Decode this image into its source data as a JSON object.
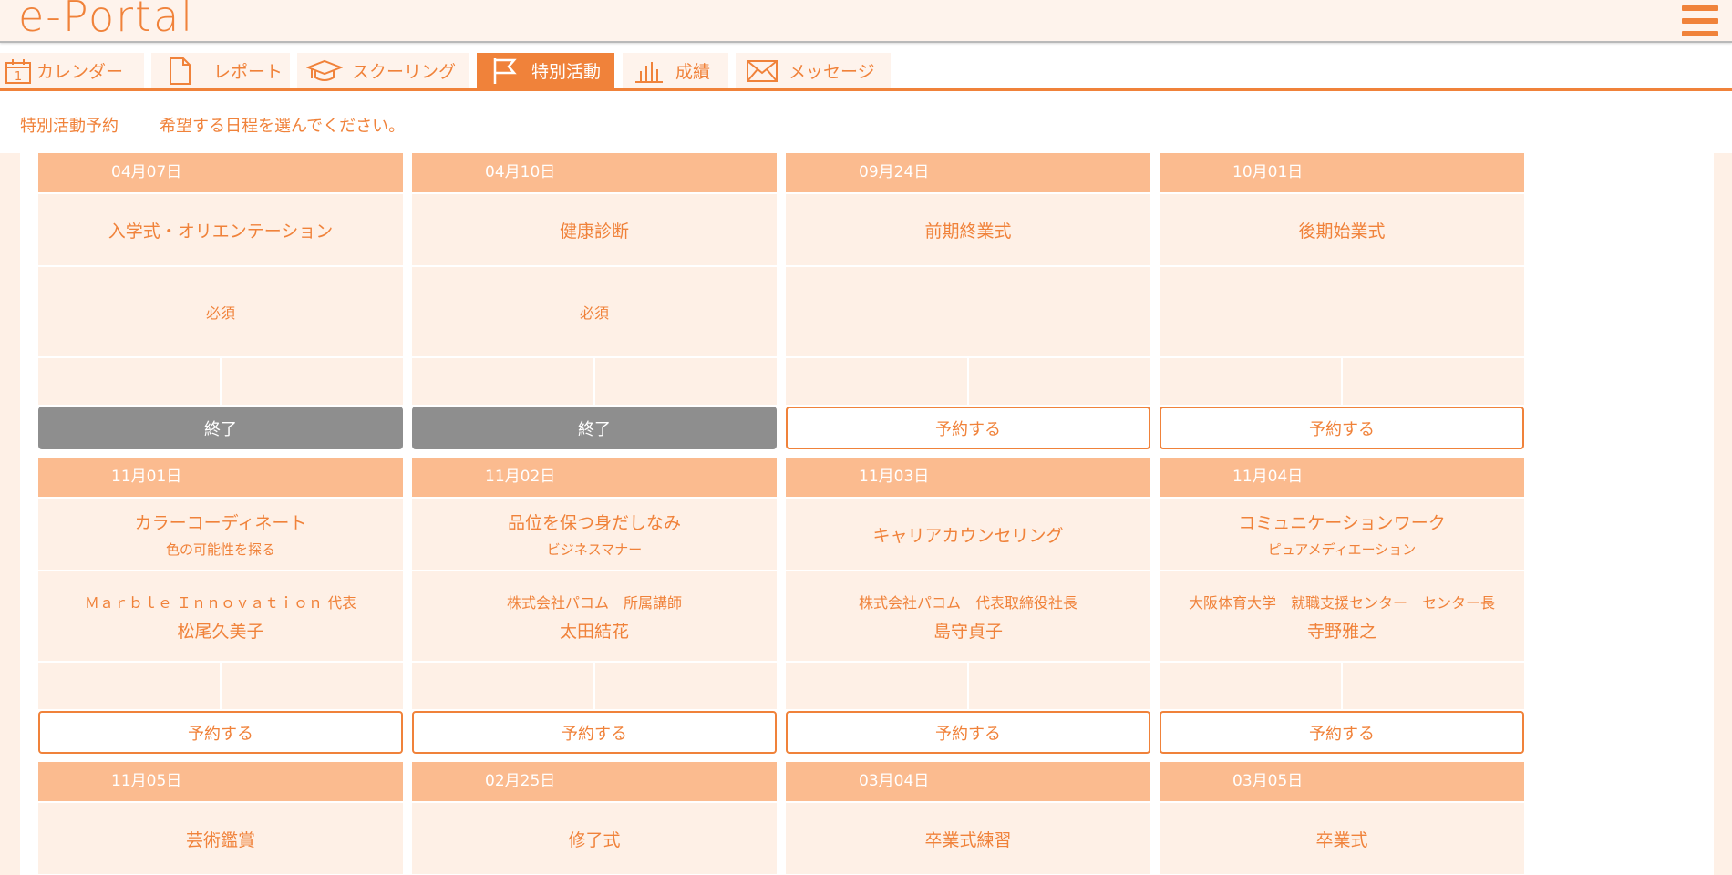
{
  "app": {
    "logo": "e-Portal"
  },
  "tabs": [
    {
      "label": "カレンダー",
      "icon": "calendar-icon",
      "active": false
    },
    {
      "label": "レポート",
      "icon": "document-icon",
      "active": false
    },
    {
      "label": "スクーリング",
      "icon": "graduation-cap-icon",
      "active": false
    },
    {
      "label": "特別活動",
      "icon": "flag-icon",
      "active": true
    },
    {
      "label": "成績",
      "icon": "bar-chart-icon",
      "active": false
    },
    {
      "label": "メッセージ",
      "icon": "envelope-icon",
      "active": false
    }
  ],
  "calendar_icon_day": "1",
  "subheader": {
    "title": "特別活動予約",
    "message": "希望する日程を選んでください。"
  },
  "colors": {
    "accent": "#f0823a",
    "header_bg": "#fbbb8f",
    "cell_bg": "#fef0e6",
    "done_bg": "#8e8e8e"
  },
  "cards": [
    {
      "date": "04月07日",
      "title": "入学式・オリエンテーション",
      "subtitle": "",
      "affiliation": "必須",
      "name": "",
      "action": "終了",
      "status": "done"
    },
    {
      "date": "04月10日",
      "title": "健康診断",
      "subtitle": "",
      "affiliation": "必須",
      "name": "",
      "action": "終了",
      "status": "done"
    },
    {
      "date": "09月24日",
      "title": "前期終業式",
      "subtitle": "",
      "affiliation": "",
      "name": "",
      "action": "予約する",
      "status": "open"
    },
    {
      "date": "10月01日",
      "title": "後期始業式",
      "subtitle": "",
      "affiliation": "",
      "name": "",
      "action": "予約する",
      "status": "open"
    },
    {
      "date": "11月01日",
      "title": "カラーコーディネート",
      "subtitle": "色の可能性を探る",
      "affiliation": "Ｍａｒｂｌｅ Ｉｎｎｏｖａｔｉｏｎ 代表",
      "name": "松尾久美子",
      "action": "予約する",
      "status": "open"
    },
    {
      "date": "11月02日",
      "title": "品位を保つ身だしなみ",
      "subtitle": "ビジネスマナー",
      "affiliation": "株式会社パコム　所属講師",
      "name": "太田結花",
      "action": "予約する",
      "status": "open"
    },
    {
      "date": "11月03日",
      "title": "キャリアカウンセリング",
      "subtitle": "",
      "affiliation": "株式会社パコム　代表取締役社長",
      "name": "島守貞子",
      "action": "予約する",
      "status": "open"
    },
    {
      "date": "11月04日",
      "title": "コミュニケーションワーク",
      "subtitle": "ピュアメディエーション",
      "affiliation": "大阪体育大学　就職支援センター　センター長",
      "name": "寺野雅之",
      "action": "予約する",
      "status": "open"
    },
    {
      "date": "11月05日",
      "title": "芸術鑑賞",
      "subtitle": "",
      "affiliation": "",
      "name": "",
      "action": "",
      "status": ""
    },
    {
      "date": "02月25日",
      "title": "修了式",
      "subtitle": "",
      "affiliation": "",
      "name": "",
      "action": "",
      "status": ""
    },
    {
      "date": "03月04日",
      "title": "卒業式練習",
      "subtitle": "",
      "affiliation": "",
      "name": "",
      "action": "",
      "status": ""
    },
    {
      "date": "03月05日",
      "title": "卒業式",
      "subtitle": "",
      "affiliation": "",
      "name": "",
      "action": "",
      "status": ""
    }
  ]
}
